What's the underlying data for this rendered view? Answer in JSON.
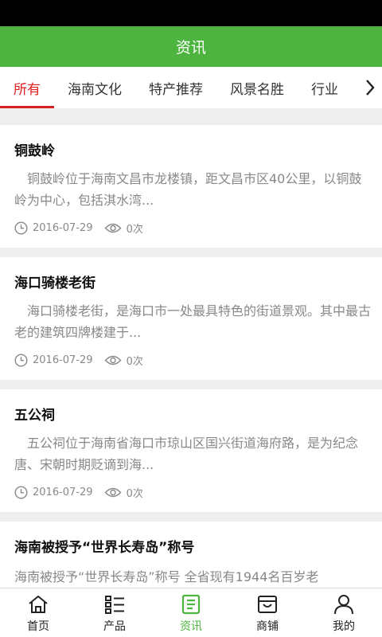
{
  "header": {
    "title": "资讯"
  },
  "tabs": [
    {
      "label": "所有"
    },
    {
      "label": "海南文化"
    },
    {
      "label": "特产推荐"
    },
    {
      "label": "风景名胜"
    },
    {
      "label": "行业"
    }
  ],
  "articles": [
    {
      "title": "铜鼓岭",
      "summary": "铜鼓岭位于海南文昌市龙楼镇，距文昌市区40公里，以铜鼓岭为中心，包括淇水湾...",
      "date": "2016-07-29",
      "views": "0次"
    },
    {
      "title": "海口骑楼老街",
      "summary": "海口骑楼老街，是海口市一处最具特色的街道景观。其中最古老的建筑四牌楼建于...",
      "date": "2016-07-29",
      "views": "0次"
    },
    {
      "title": "五公祠",
      "summary": "五公祠位于海南省海口市琼山区国兴街道海府路，是为纪念唐、宋朝时期贬谪到海...",
      "date": "2016-07-29",
      "views": "0次"
    },
    {
      "title": "海南被授予“世界长寿岛”称号",
      "summary": "海南被授予“世界长寿岛”称号 全省现有1944名百岁老",
      "date": "",
      "views": ""
    }
  ],
  "bottom_nav": [
    {
      "label": "首页",
      "icon": "home-icon"
    },
    {
      "label": "产品",
      "icon": "list-icon"
    },
    {
      "label": "资讯",
      "icon": "news-icon"
    },
    {
      "label": "商铺",
      "icon": "shop-icon"
    },
    {
      "label": "我的",
      "icon": "user-icon"
    }
  ],
  "colors": {
    "primary": "#4db53f",
    "active_tab": "#e02020"
  }
}
